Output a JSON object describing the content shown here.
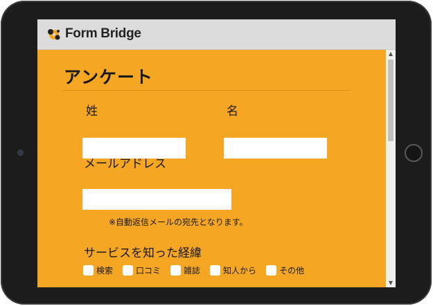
{
  "header": {
    "logo_text": "Form Bridge"
  },
  "form": {
    "title": "アンケート",
    "last_name_label": "姓",
    "first_name_label": "名",
    "last_name_value": "",
    "first_name_value": "",
    "email_label": "メールアドレス",
    "email_value": "",
    "email_note": "※自動返信メールの宛先となります。",
    "source_label": "サービスを知った経緯",
    "source_options": [
      "検索",
      "口コミ",
      "雑誌",
      "知人から",
      "その他"
    ]
  },
  "colors": {
    "form_background": "#f5a623",
    "header_background": "#dcdcdc",
    "device_frame": "#1c1c1c"
  }
}
